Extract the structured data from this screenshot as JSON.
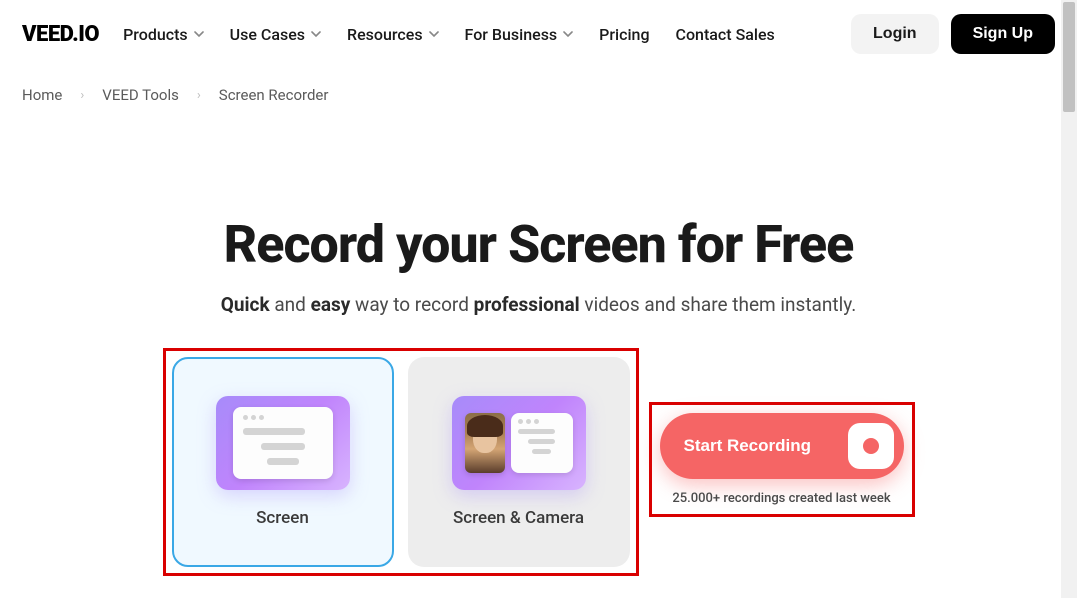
{
  "logo": "VEED.IO",
  "nav": {
    "items": [
      {
        "label": "Products",
        "dropdown": true
      },
      {
        "label": "Use Cases",
        "dropdown": true
      },
      {
        "label": "Resources",
        "dropdown": true
      },
      {
        "label": "For Business",
        "dropdown": true
      },
      {
        "label": "Pricing",
        "dropdown": false
      },
      {
        "label": "Contact Sales",
        "dropdown": false
      }
    ],
    "login": "Login",
    "signup": "Sign Up"
  },
  "breadcrumb": {
    "items": [
      "Home",
      "VEED Tools",
      "Screen Recorder"
    ]
  },
  "hero": {
    "title": "Record your Screen for Free",
    "sub_prefix": "",
    "sub_b1": "Quick",
    "sub_mid1": " and ",
    "sub_b2": "easy",
    "sub_mid2": " way to record ",
    "sub_b3": "professional",
    "sub_suffix": " videos and share them instantly."
  },
  "options": {
    "screen": "Screen",
    "screen_camera": "Screen & Camera"
  },
  "cta": {
    "label": "Start Recording",
    "sub": "25.000+ recordings created last week"
  }
}
